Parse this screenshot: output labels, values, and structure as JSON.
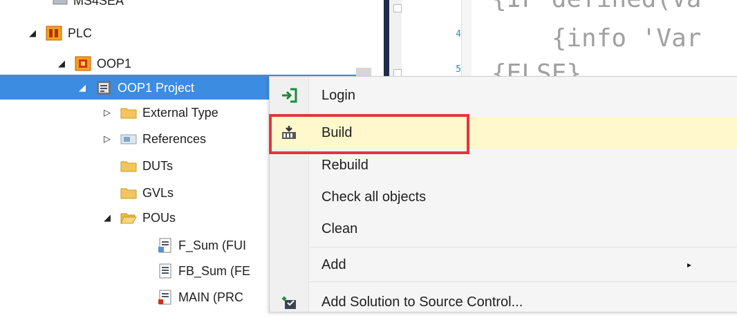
{
  "editor": {
    "lines": [
      {
        "num": "",
        "text": "{IF defined(Va"
      },
      {
        "num": "4",
        "text": "    {info 'Var"
      },
      {
        "num": "5",
        "text": "{ELSE}"
      }
    ]
  },
  "tree": {
    "items": [
      {
        "label": "MS4SEA",
        "icon": "device-icon",
        "expanded": null
      },
      {
        "label": "PLC",
        "icon": "plc-icon",
        "expanded": true
      },
      {
        "label": "OOP1",
        "icon": "plc-project-icon",
        "expanded": true
      },
      {
        "label": "OOP1 Project",
        "icon": "project-icon",
        "expanded": true,
        "selected": true
      },
      {
        "label": "External Type",
        "icon": "folder-icon",
        "expanded": false
      },
      {
        "label": "References",
        "icon": "references-icon",
        "expanded": false
      },
      {
        "label": "DUTs",
        "icon": "folder-icon",
        "expanded": null
      },
      {
        "label": "GVLs",
        "icon": "folder-icon",
        "expanded": null
      },
      {
        "label": "POUs",
        "icon": "folder-open-icon",
        "expanded": true
      },
      {
        "label": "F_Sum (FUI",
        "icon": "function-icon",
        "expanded": null
      },
      {
        "label": "FB_Sum (FE",
        "icon": "function-block-icon",
        "expanded": null
      },
      {
        "label": "MAIN (PRC",
        "icon": "program-icon",
        "expanded": null
      }
    ]
  },
  "context_menu": {
    "items": [
      {
        "label": "Login",
        "icon": "login-icon"
      },
      {
        "label": "Build",
        "icon": "build-icon",
        "highlighted": true
      },
      {
        "label": "Rebuild",
        "icon": ""
      },
      {
        "label": "Check all objects",
        "icon": ""
      },
      {
        "label": "Clean",
        "icon": ""
      },
      {
        "label": "Add",
        "icon": "",
        "submenu_arrow": "▸"
      },
      {
        "label": "Add Solution to Source Control...",
        "icon": "source-control-icon"
      }
    ]
  },
  "colors": {
    "selection": "#3c8ce1",
    "menu_hover": "#fff8cc",
    "annotation_box": "#e8333a"
  }
}
